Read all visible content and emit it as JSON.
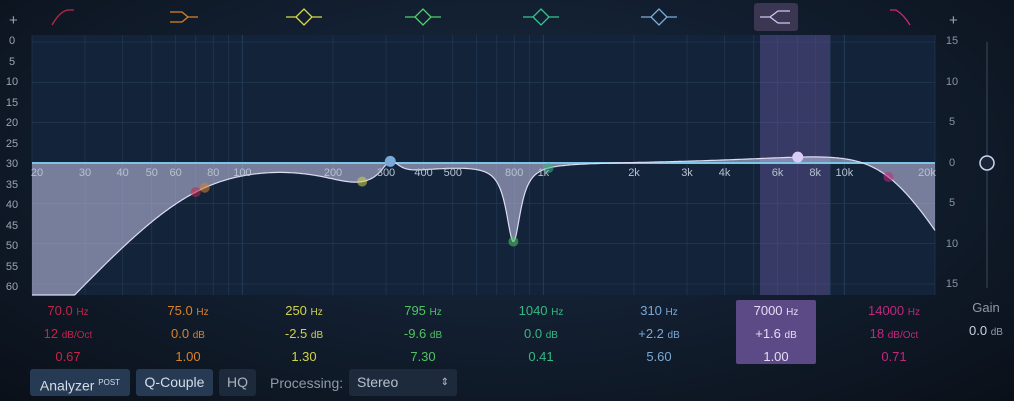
{
  "icons": [
    {
      "name": "low-cut-icon",
      "color": "#c2264a"
    },
    {
      "name": "low-shelf-icon",
      "color": "#d9822b"
    },
    {
      "name": "peak-band-1-icon",
      "color": "#d9d94a"
    },
    {
      "name": "peak-band-2-icon",
      "color": "#4fd16a"
    },
    {
      "name": "peak-band-3-icon",
      "color": "#35c58e"
    },
    {
      "name": "peak-band-4-icon",
      "color": "#7aaede"
    },
    {
      "name": "high-shelf-icon",
      "color": "#d4c4f2"
    },
    {
      "name": "high-cut-icon",
      "color": "#d0287f"
    }
  ],
  "add_left": "+",
  "add_right": "+",
  "analyzer_scale": [
    "0",
    "5",
    "10",
    "15",
    "20",
    "25",
    "30",
    "35",
    "40",
    "45",
    "50",
    "55",
    "60"
  ],
  "gain_scale": [
    "15",
    "10",
    "5",
    "0",
    "5",
    "10",
    "15"
  ],
  "freq_labels": [
    [
      "20",
      20
    ],
    [
      "30",
      30
    ],
    [
      "40",
      40
    ],
    [
      "50",
      50
    ],
    [
      "60",
      60
    ],
    [
      "80",
      80
    ],
    [
      "100",
      100
    ],
    [
      "200",
      200
    ],
    [
      "300",
      300
    ],
    [
      "400",
      400
    ],
    [
      "500",
      500
    ],
    [
      "800",
      800
    ],
    [
      "1k",
      1000
    ],
    [
      "2k",
      2000
    ],
    [
      "3k",
      3000
    ],
    [
      "4k",
      4000
    ],
    [
      "6k",
      6000
    ],
    [
      "8k",
      8000
    ],
    [
      "10k",
      10000
    ],
    [
      "20k",
      20000
    ]
  ],
  "bands": [
    {
      "freq": "70.0",
      "freq_unit": "Hz",
      "gain": "12",
      "gain_unit": "dB/Oct",
      "q": "0.67",
      "color": "#c2264a",
      "type": "hp",
      "f": 70,
      "g": 0,
      "qv": 0.67,
      "order": 2
    },
    {
      "freq": "75.0",
      "freq_unit": "Hz",
      "gain": "0.0",
      "gain_unit": "dB",
      "q": "1.00",
      "color": "#d9822b",
      "type": "ls",
      "f": 75,
      "g": 0,
      "qv": 1
    },
    {
      "freq": "250",
      "freq_unit": "Hz",
      "gain": "-2.5",
      "gain_unit": "dB",
      "q": "1.30",
      "color": "#d2d24a",
      "type": "pk",
      "f": 250,
      "g": -2.5,
      "qv": 1.3
    },
    {
      "freq": "795",
      "freq_unit": "Hz",
      "gain": "-9.6",
      "gain_unit": "dB",
      "q": "7.30",
      "color": "#4fc461",
      "type": "pk",
      "f": 795,
      "g": -9.6,
      "qv": 7.3
    },
    {
      "freq": "1040",
      "freq_unit": "Hz",
      "gain": "0.0",
      "gain_unit": "dB",
      "q": "0.41",
      "color": "#35b982",
      "type": "pk",
      "f": 1040,
      "g": 0,
      "qv": 0.41
    },
    {
      "freq": "310",
      "freq_unit": "Hz",
      "gain": "+2.2",
      "gain_unit": "dB",
      "q": "5.60",
      "color": "#7aa8d6",
      "type": "pk",
      "f": 310,
      "g": 2.2,
      "qv": 5.6
    },
    {
      "freq": "7000",
      "freq_unit": "Hz",
      "gain": "+1.6",
      "gain_unit": "dB",
      "q": "1.00",
      "color": "#d9cdf5",
      "type": "hs",
      "f": 7000,
      "g": 1.6,
      "qv": 1,
      "selected": true
    },
    {
      "freq": "14000",
      "freq_unit": "Hz",
      "gain": "18",
      "gain_unit": "dB/Oct",
      "q": "0.71",
      "color": "#c2267f",
      "type": "lp",
      "f": 14000,
      "g": 0,
      "qv": 0.71,
      "order": 3
    }
  ],
  "gain": {
    "label": "Gain",
    "value": "0.0",
    "unit": "dB"
  },
  "toolbar": {
    "analyzer": "Analyzer",
    "analyzer_mode": "POST",
    "q_couple": "Q-Couple",
    "hq": "HQ",
    "processing_label": "Processing:",
    "processing_value": "Stereo"
  }
}
